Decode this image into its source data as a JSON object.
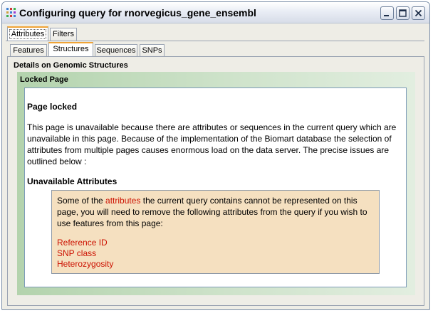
{
  "window": {
    "title": "Configuring query for rnorvegicus_gene_ensembl"
  },
  "outer_tabs": [
    {
      "label": "Attributes",
      "selected": true
    },
    {
      "label": "Filters",
      "selected": false
    }
  ],
  "inner_tabs": [
    {
      "label": "Features",
      "selected": false
    },
    {
      "label": "Structures",
      "selected": true
    },
    {
      "label": "Sequences",
      "selected": false
    },
    {
      "label": "SNPs",
      "selected": false
    }
  ],
  "panel": {
    "section_title": "Details on Genomic Structures",
    "box_title": "Locked Page",
    "heading": "Page locked",
    "description": "This page is unavailable because there are attributes or sequences in the current query which are unavailable in this page. Because of the implementation of the Biomart database the selection of attributes from multiple pages causes enormous load on the data server. The precise issues are outlined below :",
    "unavailable_heading": "Unavailable Attributes",
    "notice": {
      "before_link": "Some of the ",
      "link_word": "attributes",
      "after_link": " the current query contains cannot be represented on this page, you will need to remove the following attributes from the query if you wish to use features from this page:"
    },
    "attributes": [
      "Reference ID",
      "SNP class",
      "Heterozygosity"
    ]
  },
  "colors": {
    "accent_tab": "#f0a436",
    "warning_red": "#cc1100",
    "notice_bg": "#f5e0c0",
    "frame_green": "#b3d3ad"
  },
  "icons": [
    "biomart-app-icon",
    "minimize-icon",
    "maximize-icon",
    "close-icon"
  ]
}
